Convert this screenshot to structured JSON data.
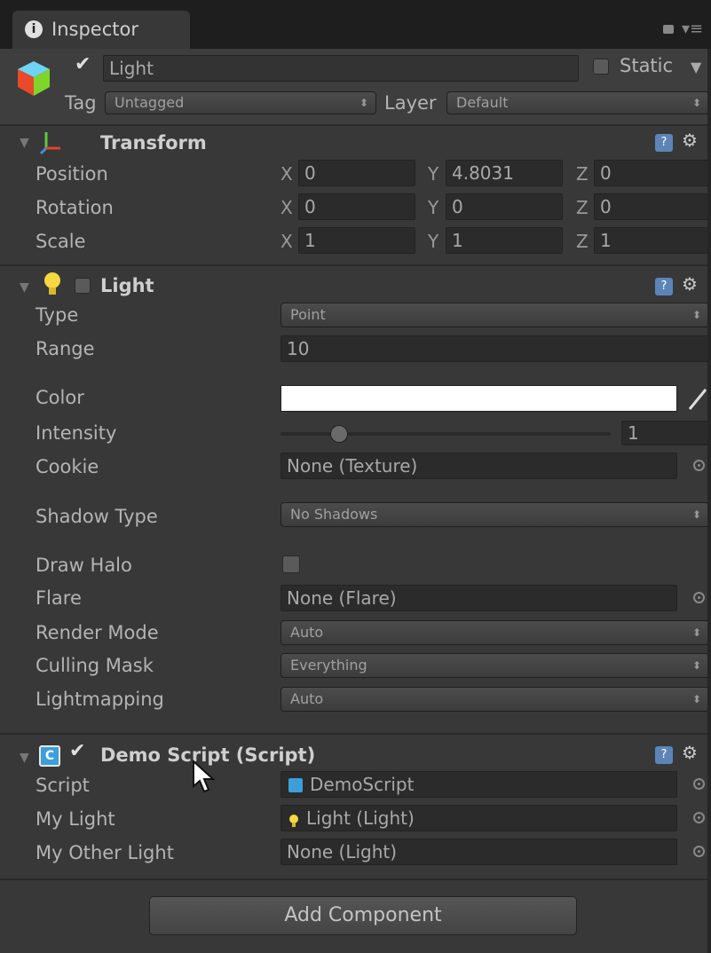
{
  "tab": {
    "title": "Inspector",
    "info_icon": "i"
  },
  "object": {
    "name": "Light",
    "static_label": "Static",
    "tag_label": "Tag",
    "tag_value": "Untagged",
    "layer_label": "Layer",
    "layer_value": "Default"
  },
  "transform": {
    "title": "Transform",
    "rows": [
      {
        "label": "Position",
        "x": "0",
        "y": "4.8031",
        "z": "0"
      },
      {
        "label": "Rotation",
        "x": "0",
        "y": "0",
        "z": "0"
      },
      {
        "label": "Scale",
        "x": "1",
        "y": "1",
        "z": "1"
      }
    ],
    "axes": {
      "x": "X",
      "y": "Y",
      "z": "Z"
    }
  },
  "light": {
    "title": "Light",
    "type_label": "Type",
    "type_value": "Point",
    "range_label": "Range",
    "range_value": "10",
    "color_label": "Color",
    "color_value": "#ffffff",
    "intensity_label": "Intensity",
    "intensity_value": "1",
    "intensity_fraction": 0.15,
    "cookie_label": "Cookie",
    "cookie_value": "None (Texture)",
    "shadow_label": "Shadow Type",
    "shadow_value": "No Shadows",
    "halo_label": "Draw Halo",
    "flare_label": "Flare",
    "flare_value": "None (Flare)",
    "render_label": "Render Mode",
    "render_value": "Auto",
    "culling_label": "Culling Mask",
    "culling_value": "Everything",
    "lightmapping_label": "Lightmapping",
    "lightmapping_value": "Auto"
  },
  "script": {
    "title": "Demo Script (Script)",
    "script_label": "Script",
    "script_value": "DemoScript",
    "mylight_label": "My Light",
    "mylight_value": "Light (Light)",
    "other_label": "My Other Light",
    "other_value": "None (Light)"
  },
  "add_component": "Add Component",
  "help_glyph": "?",
  "colors": {
    "panel": "#383838",
    "field": "#2b2b2b",
    "accent": "#5d84b7"
  }
}
